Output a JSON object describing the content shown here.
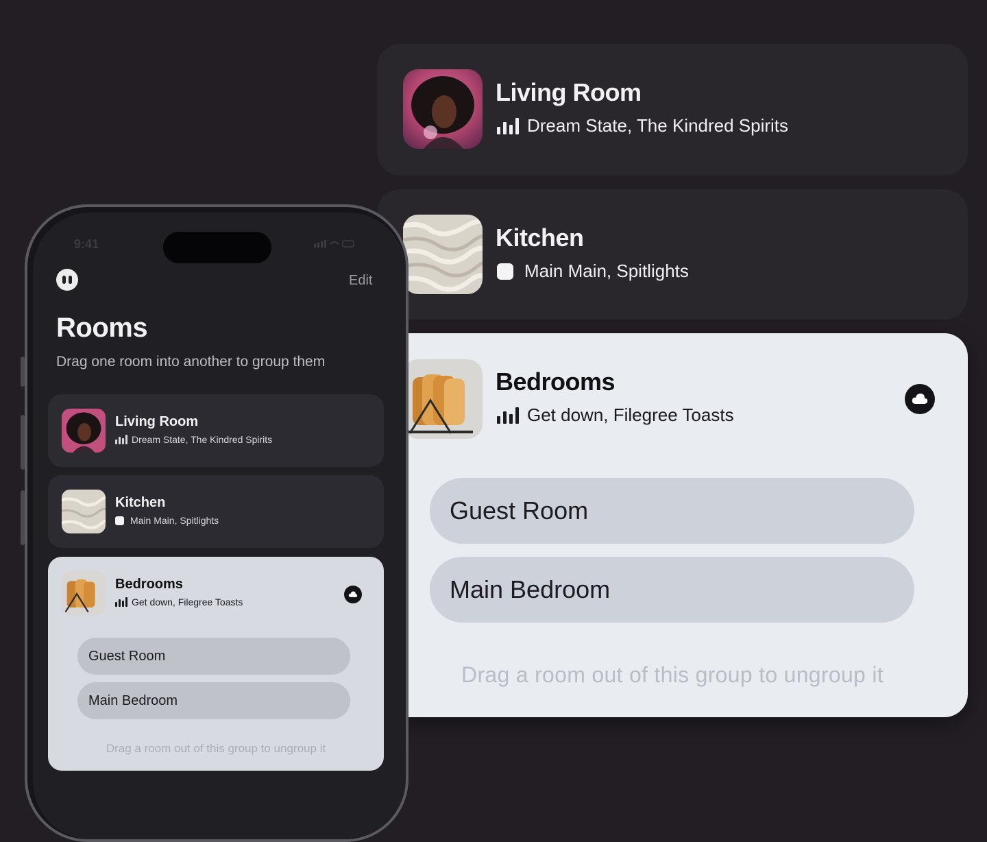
{
  "colors": {
    "background": "#221e24",
    "dark_card": "#29262c",
    "light_card": "#e9ecf0",
    "pill": "#cdd1da"
  },
  "big_cards": {
    "living": {
      "title": "Living Room",
      "subtitle": "Dream State, The Kindred Spirits",
      "status_icon": "playing-bars-icon"
    },
    "kitchen": {
      "title": "Kitchen",
      "subtitle": "Main Main, Spitlights",
      "status_icon": "stopped-square-icon"
    },
    "bedrooms": {
      "title": "Bedrooms",
      "subtitle": "Get down, Filegree Toasts",
      "status_icon": "playing-bars-icon",
      "action_icon": "cloud-icon",
      "rooms": [
        "Guest Room",
        "Main Bedroom"
      ],
      "hint": "Drag a room out of this group to ungroup it"
    }
  },
  "phone": {
    "status_time": "9:41",
    "edit_label": "Edit",
    "title": "Rooms",
    "subtitle": "Drag one room into another to group them",
    "cards": {
      "living": {
        "title": "Living Room",
        "subtitle": "Dream State, The Kindred Spirits"
      },
      "kitchen": {
        "title": "Kitchen",
        "subtitle": "Main Main, Spitlights"
      },
      "bedrooms": {
        "title": "Bedrooms",
        "subtitle": "Get down, Filegree Toasts",
        "rooms": [
          "Guest Room",
          "Main Bedroom"
        ],
        "hint": "Drag a room out of this group to ungroup it"
      }
    }
  }
}
